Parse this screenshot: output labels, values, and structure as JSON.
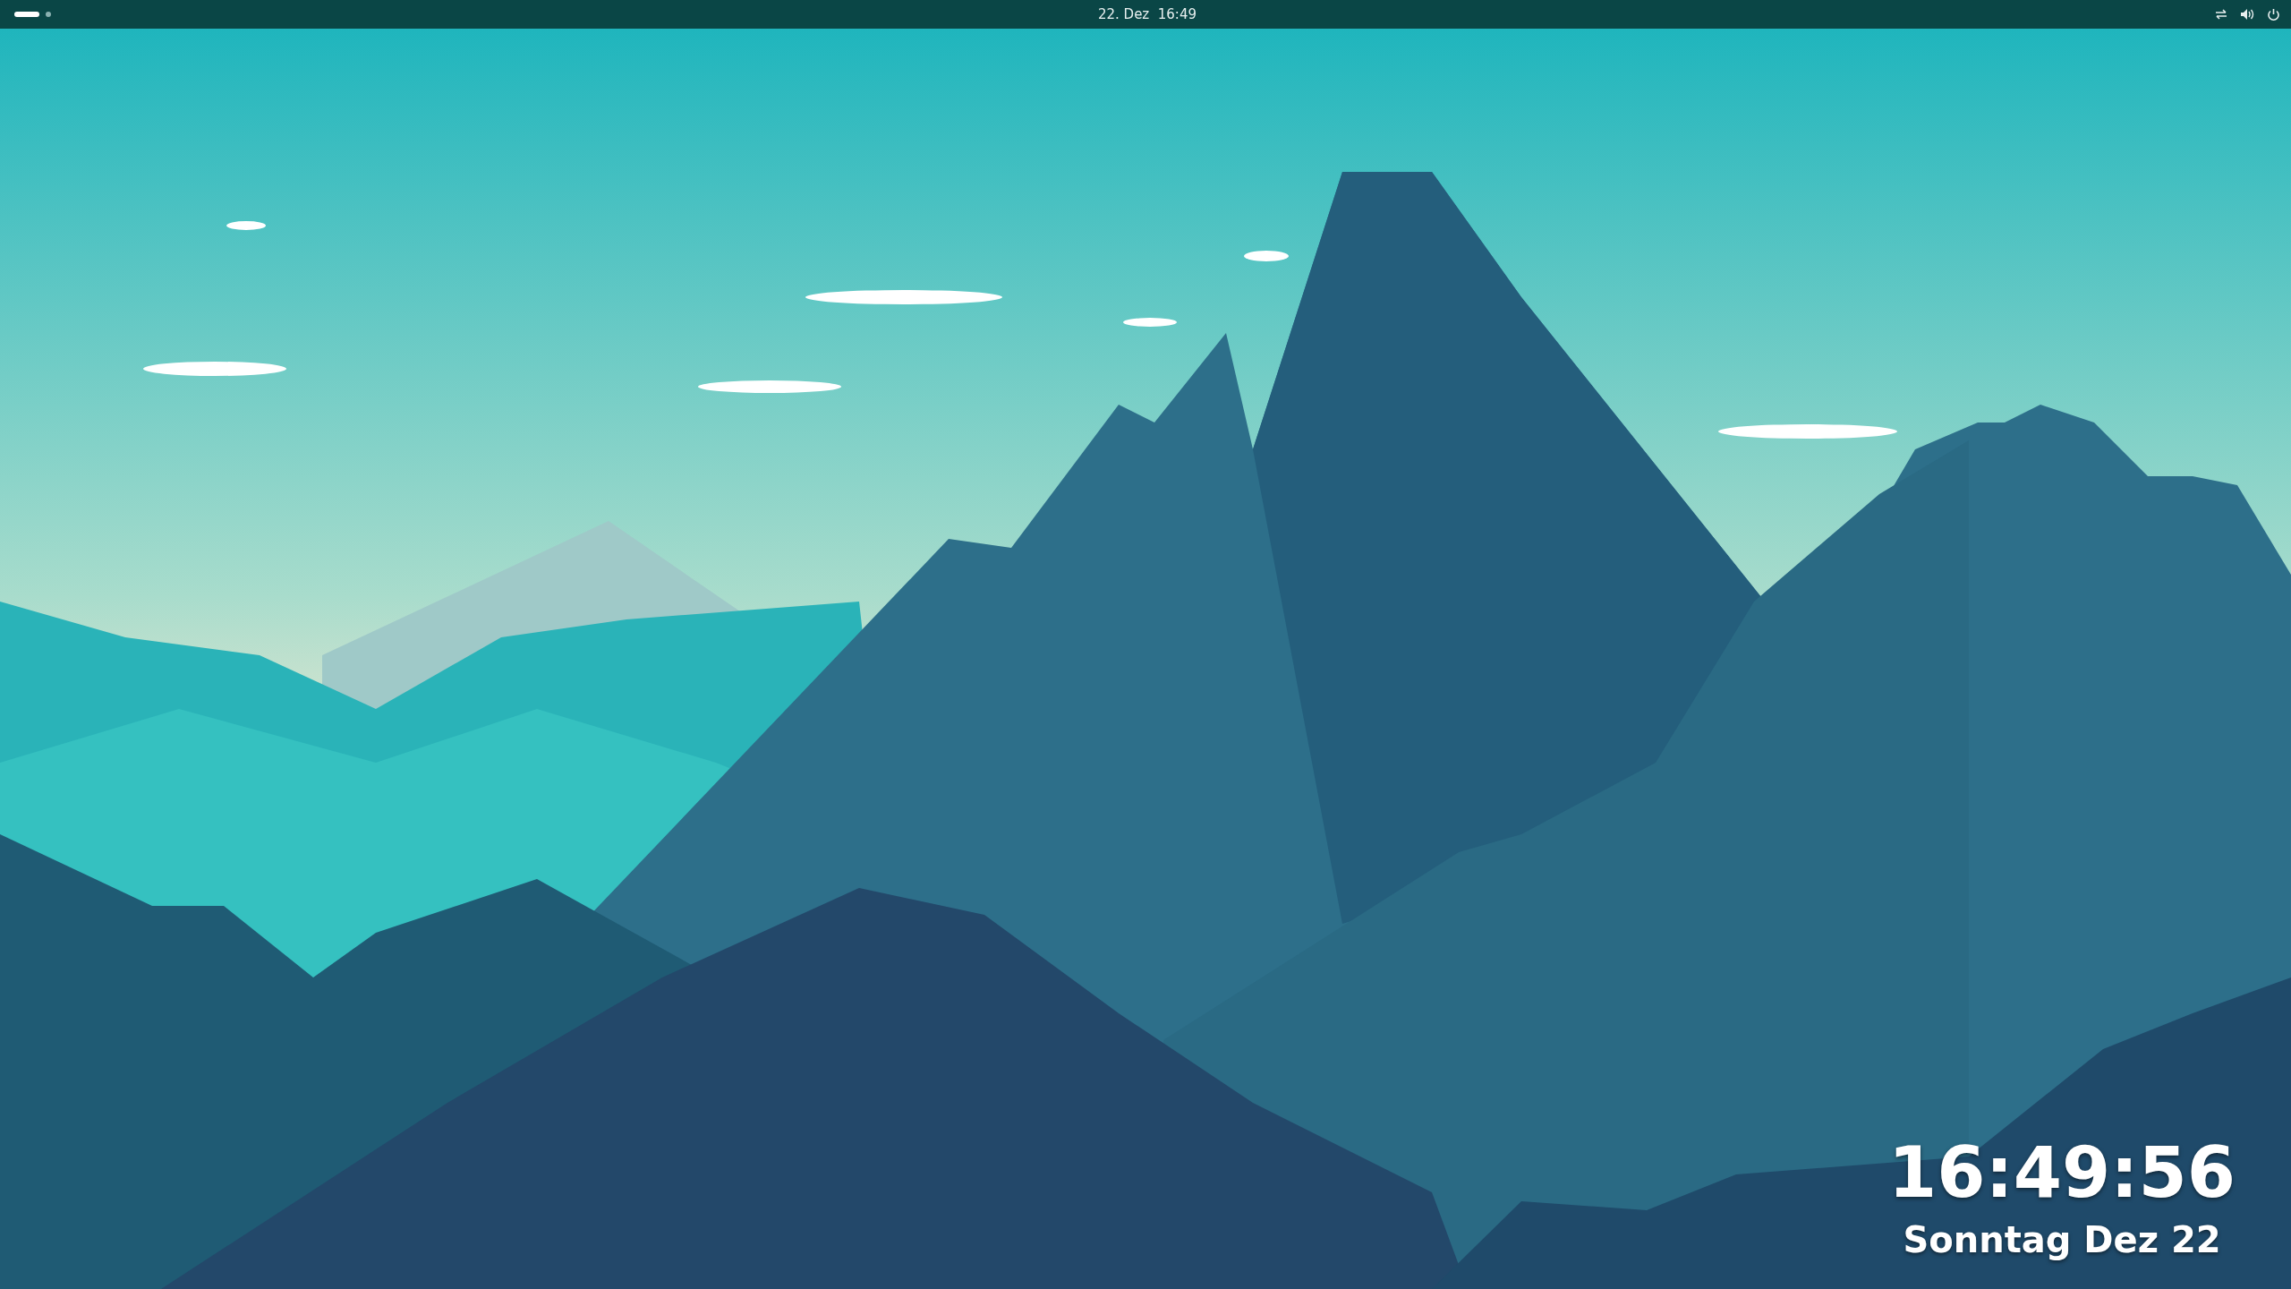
{
  "top_bar": {
    "workspaces": [
      {
        "selected": true
      },
      {
        "selected": false
      }
    ],
    "clock": "22. Dez  16:49"
  },
  "desktop_clock": {
    "time": "16:49:56",
    "date": "Sonntag Dez 22"
  }
}
